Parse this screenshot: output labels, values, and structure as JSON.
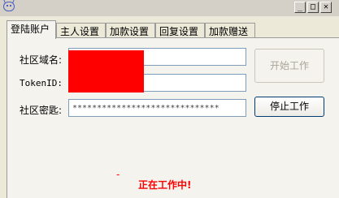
{
  "window": {
    "minimize_glyph": "_",
    "maximize_glyph": "□",
    "close_glyph": "✕"
  },
  "tabs": [
    {
      "label": "登陆账户",
      "active": true
    },
    {
      "label": "主人设置",
      "active": false
    },
    {
      "label": "加款设置",
      "active": false
    },
    {
      "label": "回复设置",
      "active": false
    },
    {
      "label": "加款赠送",
      "active": false
    }
  ],
  "form": {
    "community_domain_label": "社区域名:",
    "token_id_label": "TokenID:",
    "community_secret_label": "社区密匙:",
    "community_domain_value": "",
    "token_id_value": "",
    "community_secret_value": "******************************"
  },
  "buttons": {
    "start_label": "开始工作",
    "stop_label": "停止工作"
  },
  "status": {
    "dash": "-",
    "text": "正在工作中!"
  },
  "colors": {
    "status": "#ff0000",
    "redaction": "#ff0000"
  }
}
